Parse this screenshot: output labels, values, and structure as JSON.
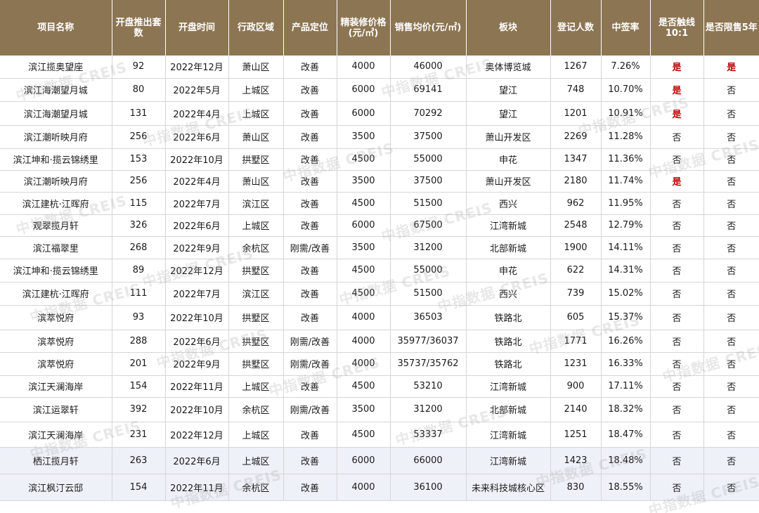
{
  "columns": [
    "项目名称",
    "开盘推出套数",
    "开盘时间",
    "行政区域",
    "产品定位",
    "精装修价格(元/㎡)",
    "销售均价(元/㎡)",
    "板块",
    "登记人数",
    "中签率",
    "是否触线10:1",
    "是否限售5年"
  ],
  "rows": [
    {
      "name": "滨江揽奥望座",
      "units": "92",
      "date": "2022年12月",
      "district": "萧山区",
      "positioning": "改善",
      "decor_price": "4000",
      "avg_price": "46000",
      "plate": "奥体博览城",
      "registrants": "1267",
      "rate": "7.26%",
      "touch_line": "是",
      "restricted": "是"
    },
    {
      "name": "滨江海潮望月城",
      "units": "80",
      "date": "2022年5月",
      "district": "上城区",
      "positioning": "改善",
      "decor_price": "6000",
      "avg_price": "69141",
      "plate": "望江",
      "registrants": "748",
      "rate": "10.70%",
      "touch_line": "是",
      "restricted": "否"
    },
    {
      "name": "滨江海潮望月城",
      "units": "131",
      "date": "2022年4月",
      "district": "上城区",
      "positioning": "改善",
      "decor_price": "6000",
      "avg_price": "70292",
      "plate": "望江",
      "registrants": "1201",
      "rate": "10.91%",
      "touch_line": "是",
      "restricted": "否"
    },
    {
      "name": "滨江潮听映月府",
      "units": "256",
      "date": "2022年6月",
      "district": "萧山区",
      "positioning": "改善",
      "decor_price": "3500",
      "avg_price": "37500",
      "plate": "萧山开发区",
      "registrants": "2269",
      "rate": "11.28%",
      "touch_line": "否",
      "restricted": "否"
    },
    {
      "name": "滨江坤和·揽云锦绣里",
      "units": "153",
      "date": "2022年10月",
      "district": "拱墅区",
      "positioning": "改善",
      "decor_price": "4500",
      "avg_price": "55000",
      "plate": "申花",
      "registrants": "1347",
      "rate": "11.36%",
      "touch_line": "否",
      "restricted": "否"
    },
    {
      "name": "滨江潮听映月府",
      "units": "256",
      "date": "2022年4月",
      "district": "萧山区",
      "positioning": "改善",
      "decor_price": "3500",
      "avg_price": "37500",
      "plate": "萧山开发区",
      "registrants": "2180",
      "rate": "11.74%",
      "touch_line": "是",
      "restricted": "否"
    },
    {
      "name": "滨江建杭·江晖府",
      "units": "115",
      "date": "2022年7月",
      "district": "滨江区",
      "positioning": "改善",
      "decor_price": "4500",
      "avg_price": "51500",
      "plate": "西兴",
      "registrants": "962",
      "rate": "11.95%",
      "touch_line": "否",
      "restricted": "否"
    },
    {
      "name": "观翠揽月轩",
      "units": "326",
      "date": "2022年6月",
      "district": "上城区",
      "positioning": "改善",
      "decor_price": "6000",
      "avg_price": "67500",
      "plate": "江湾新城",
      "registrants": "2548",
      "rate": "12.79%",
      "touch_line": "否",
      "restricted": "否"
    },
    {
      "name": "滨江福翠里",
      "units": "268",
      "date": "2022年9月",
      "district": "余杭区",
      "positioning": "刚需/改善",
      "decor_price": "3500",
      "avg_price": "31200",
      "plate": "北部新城",
      "registrants": "1900",
      "rate": "14.11%",
      "touch_line": "否",
      "restricted": "否"
    },
    {
      "name": "滨江坤和·揽云锦绣里",
      "units": "89",
      "date": "2022年12月",
      "district": "拱墅区",
      "positioning": "改善",
      "decor_price": "4500",
      "avg_price": "55000",
      "plate": "申花",
      "registrants": "622",
      "rate": "14.31%",
      "touch_line": "否",
      "restricted": "否"
    },
    {
      "name": "滨江建杭·江晖府",
      "units": "111",
      "date": "2022年7月",
      "district": "滨江区",
      "positioning": "改善",
      "decor_price": "4500",
      "avg_price": "51500",
      "plate": "西兴",
      "registrants": "739",
      "rate": "15.02%",
      "touch_line": "否",
      "restricted": "否"
    },
    {
      "name": "滨萃悦府",
      "units": "93",
      "date": "2022年10月",
      "district": "拱墅区",
      "positioning": "改善",
      "decor_price": "4000",
      "avg_price": "36503",
      "plate": "铁路北",
      "registrants": "605",
      "rate": "15.37%",
      "touch_line": "否",
      "restricted": "否"
    },
    {
      "name": "滨萃悦府",
      "units": "288",
      "date": "2022年6月",
      "district": "拱墅区",
      "positioning": "刚需/改善",
      "decor_price": "4000",
      "avg_price": "35977/36037",
      "plate": "铁路北",
      "registrants": "1771",
      "rate": "16.26%",
      "touch_line": "否",
      "restricted": "否"
    },
    {
      "name": "滨萃悦府",
      "units": "201",
      "date": "2022年9月",
      "district": "拱墅区",
      "positioning": "刚需/改善",
      "decor_price": "4000",
      "avg_price": "35737/35762",
      "plate": "铁路北",
      "registrants": "1231",
      "rate": "16.33%",
      "touch_line": "否",
      "restricted": "否"
    },
    {
      "name": "滨江天澜海岸",
      "units": "154",
      "date": "2022年11月",
      "district": "上城区",
      "positioning": "改善",
      "decor_price": "4500",
      "avg_price": "53210",
      "plate": "江湾新城",
      "registrants": "900",
      "rate": "17.11%",
      "touch_line": "否",
      "restricted": "否"
    },
    {
      "name": "滨江运翠轩",
      "units": "392",
      "date": "2022年10月",
      "district": "余杭区",
      "positioning": "刚需/改善",
      "decor_price": "3500",
      "avg_price": "31200",
      "plate": "北部新城",
      "registrants": "2140",
      "rate": "18.32%",
      "touch_line": "否",
      "restricted": "否"
    },
    {
      "name": "滨江天澜海岸",
      "units": "231",
      "date": "2022年12月",
      "district": "上城区",
      "positioning": "改善",
      "decor_price": "4500",
      "avg_price": "53337",
      "plate": "江湾新城",
      "registrants": "1251",
      "rate": "18.47%",
      "touch_line": "否",
      "restricted": "否"
    },
    {
      "name": "栖江揽月轩",
      "units": "263",
      "date": "2022年6月",
      "district": "上城区",
      "positioning": "改善",
      "decor_price": "6000",
      "avg_price": "66000",
      "plate": "江湾新城",
      "registrants": "1423",
      "rate": "18.48%",
      "touch_line": "否",
      "restricted": "否"
    },
    {
      "name": "滨江枫汀云邸",
      "units": "154",
      "date": "2022年11月",
      "district": "余杭区",
      "positioning": "改善",
      "decor_price": "4000",
      "avg_price": "36100",
      "plate": "未来科技城核心区",
      "registrants": "830",
      "rate": "18.55%",
      "touch_line": "否",
      "restricted": "否"
    }
  ],
  "watermark": "中指数据 CREIS",
  "colors": {
    "header_bg": "#8c7552",
    "yes_text": "#c00000",
    "highlight_row": "#eef1f8"
  }
}
